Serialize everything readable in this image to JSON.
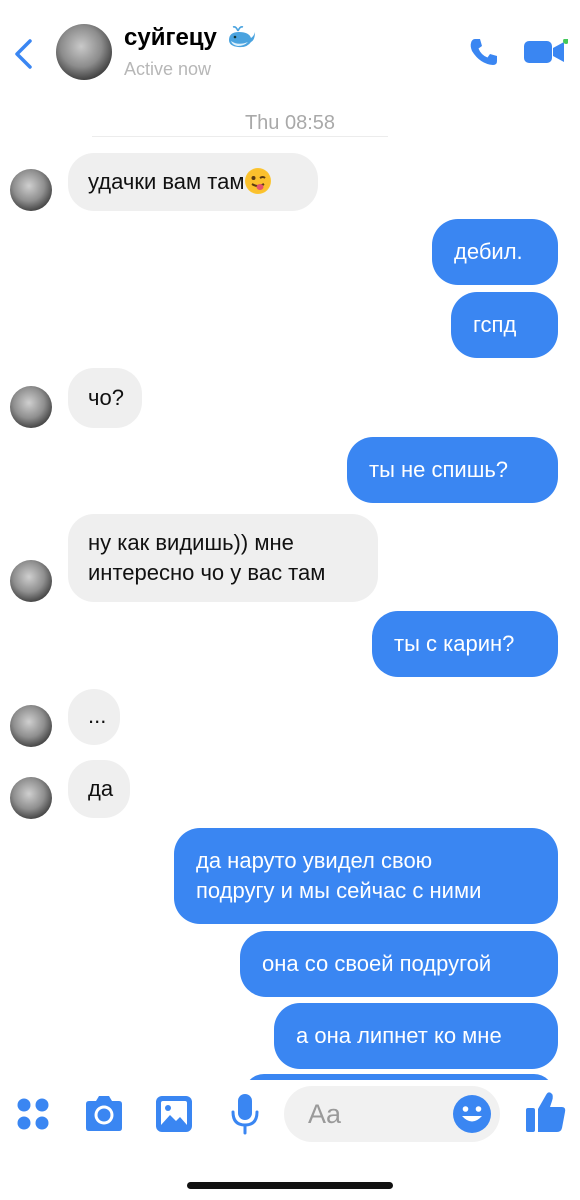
{
  "header": {
    "contact_name": "суйгецу",
    "status": "Active now",
    "whale_emoji_icon": "spouting-whale"
  },
  "timestamp": "Thu 08:58",
  "messages": [
    {
      "side": "in",
      "lines": [
        "удачки вам там"
      ],
      "emoji": "winking-face-with-tongue"
    },
    {
      "side": "out",
      "lines": [
        "дебил."
      ]
    },
    {
      "side": "out",
      "lines": [
        "гспд"
      ]
    },
    {
      "side": "in",
      "lines": [
        "чо?"
      ]
    },
    {
      "side": "out",
      "lines": [
        "ты не спишь?"
      ]
    },
    {
      "side": "in",
      "lines": [
        "ну как видишь)) мне",
        "интересно чо у вас там"
      ]
    },
    {
      "side": "out",
      "lines": [
        "ты с карин?"
      ]
    },
    {
      "side": "in",
      "lines": [
        "..."
      ]
    },
    {
      "side": "in",
      "lines": [
        "да"
      ]
    },
    {
      "side": "out",
      "lines": [
        "да наруто увидел свою",
        "подругу и мы сейчас с ними"
      ]
    },
    {
      "side": "out",
      "lines": [
        "она со своей подругой"
      ]
    },
    {
      "side": "out",
      "lines": [
        "а она липнет ко мне"
      ]
    }
  ],
  "composer": {
    "placeholder": "Aa"
  },
  "colors": {
    "accent": "#3a86f2",
    "incoming_bubble": "#efefef",
    "status_text": "#b7b7b7"
  },
  "icons": [
    "back-chevron-icon",
    "phone-icon",
    "video-camera-icon",
    "apps-grid-icon",
    "camera-icon",
    "image-icon",
    "microphone-icon",
    "emoji-icon",
    "thumbs-up-icon"
  ]
}
